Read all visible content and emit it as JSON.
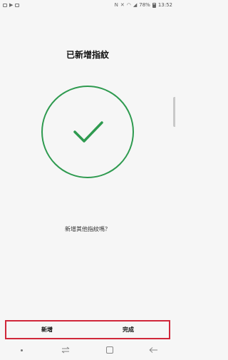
{
  "status_bar": {
    "battery": "78%",
    "time": "13:52"
  },
  "screen": {
    "title": "已新增指紋",
    "question": "新增其他指紋嗎？"
  },
  "actions": {
    "add_label": "新增",
    "done_label": "完成"
  },
  "colors": {
    "accent_green": "#2e9a4f",
    "highlight_red": "#d0273a"
  },
  "icons": {
    "success": "checkmark-circle-icon",
    "nav_recents": "recents-icon",
    "nav_home": "home-icon",
    "nav_back": "back-icon"
  }
}
